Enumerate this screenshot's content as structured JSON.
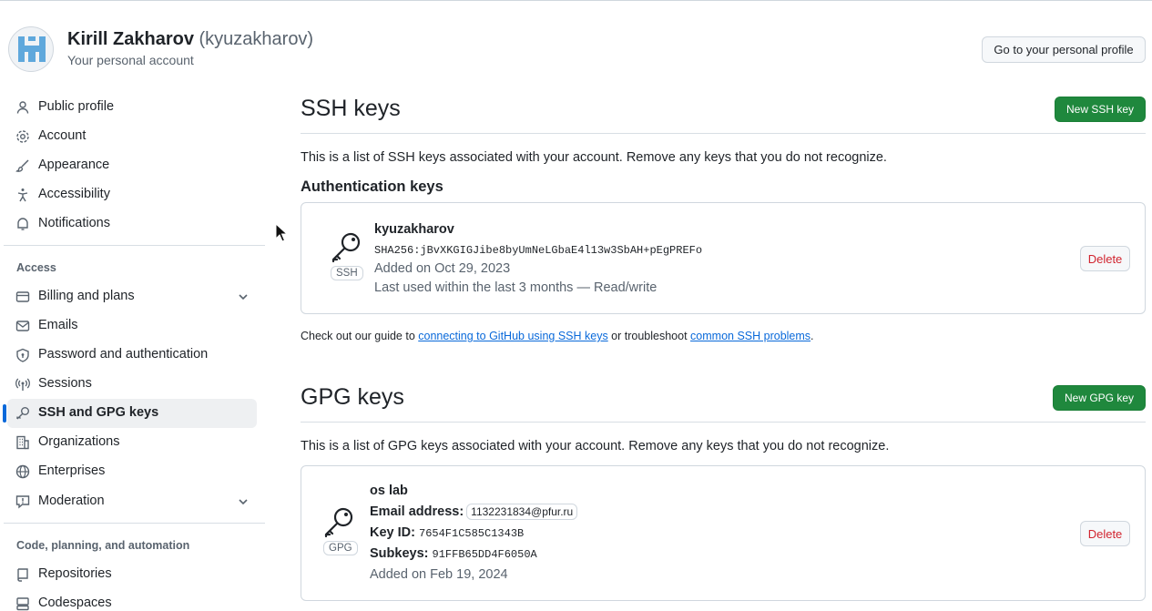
{
  "header": {
    "name": "Kirill Zakharov",
    "login": "(kyuzakharov)",
    "subtitle": "Your personal account",
    "profile_button": "Go to your personal profile"
  },
  "sidebar": {
    "items": [
      {
        "label": "Public profile",
        "icon": "person-icon"
      },
      {
        "label": "Account",
        "icon": "gear-icon"
      },
      {
        "label": "Appearance",
        "icon": "paintbrush-icon"
      },
      {
        "label": "Accessibility",
        "icon": "accessibility-icon"
      },
      {
        "label": "Notifications",
        "icon": "bell-icon"
      }
    ],
    "access_heading": "Access",
    "access_items": [
      {
        "label": "Billing and plans",
        "icon": "credit-card-icon"
      },
      {
        "label": "Emails",
        "icon": "mail-icon"
      },
      {
        "label": "Password and authentication",
        "icon": "shield-lock-icon"
      },
      {
        "label": "Sessions",
        "icon": "broadcast-icon"
      },
      {
        "label": "SSH and GPG keys",
        "icon": "key-icon"
      },
      {
        "label": "Organizations",
        "icon": "organization-icon"
      },
      {
        "label": "Enterprises",
        "icon": "globe-icon"
      },
      {
        "label": "Moderation",
        "icon": "report-icon"
      }
    ],
    "code_heading": "Code, planning, and automation",
    "code_items": [
      {
        "label": "Repositories",
        "icon": "repo-icon"
      },
      {
        "label": "Codespaces",
        "icon": "codespaces-icon"
      }
    ],
    "active": "SSH and GPG keys"
  },
  "ssh": {
    "title": "SSH keys",
    "new_button": "New SSH key",
    "description": "This is a list of SSH keys associated with your account. Remove any keys that you do not recognize.",
    "auth_heading": "Authentication keys",
    "key": {
      "badge": "SSH",
      "name": "kyuzakharov",
      "fingerprint": "SHA256:jBvXKGIGJibe8byUmNeLGbaE4l13w3SbAH+pEgPREFo",
      "added": "Added on Oct 29, 2023",
      "last_used": "Last used within the last 3 months — Read/write",
      "delete_label": "Delete"
    },
    "guide": {
      "prefix": "Check out our guide to ",
      "link1": "connecting to GitHub using SSH keys",
      "middle": " or troubleshoot ",
      "link2": "common SSH problems",
      "suffix": "."
    }
  },
  "gpg": {
    "title": "GPG keys",
    "new_button": "New GPG key",
    "description": "This is a list of GPG keys associated with your account. Remove any keys that you do not recognize.",
    "key": {
      "badge": "GPG",
      "name": "os lab",
      "email_label": "Email address:",
      "email": "1132231834@pfur.ru",
      "key_id_label": "Key ID:",
      "key_id": "7654F1C585C1343B",
      "subkeys_label": "Subkeys:",
      "subkeys": "91FFB65DD4F6050A",
      "added": "Added on Feb 19, 2024",
      "delete_label": "Delete"
    }
  },
  "colors": {
    "accent": "#0969da",
    "green": "#1f883d",
    "danger": "#d1242f",
    "muted": "#59636e"
  }
}
